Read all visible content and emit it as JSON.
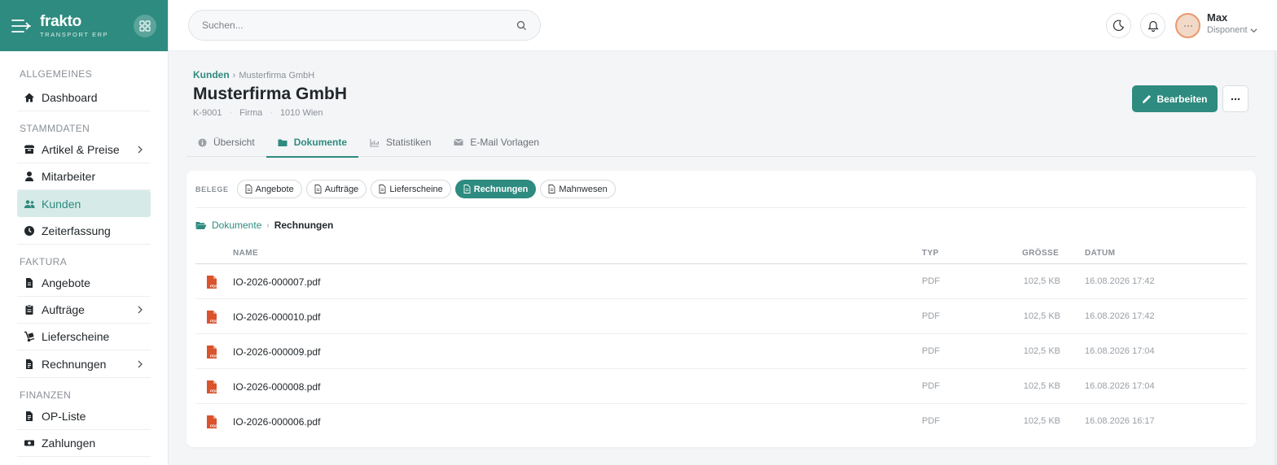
{
  "brand": {
    "name": "frakto",
    "tagline": "TRANSPORT ERP"
  },
  "sidebar": {
    "sections": [
      {
        "title": "ALLGEMEINES",
        "items": [
          {
            "label": "Dashboard",
            "icon": "home-icon"
          }
        ]
      },
      {
        "title": "STAMMDATEN",
        "items": [
          {
            "label": "Artikel & Preise",
            "icon": "box-icon",
            "chevron": true
          },
          {
            "label": "Mitarbeiter",
            "icon": "user-icon"
          },
          {
            "label": "Kunden",
            "icon": "users-icon",
            "active": true
          },
          {
            "label": "Zeiterfassung",
            "icon": "clock-icon"
          }
        ]
      },
      {
        "title": "FAKTURA",
        "items": [
          {
            "label": "Angebote",
            "icon": "document-icon"
          },
          {
            "label": "Aufträge",
            "icon": "clipboard-icon",
            "chevron": true
          },
          {
            "label": "Lieferscheine",
            "icon": "dolly-icon"
          },
          {
            "label": "Rechnungen",
            "icon": "invoice-icon",
            "chevron": true
          }
        ]
      },
      {
        "title": "FINANZEN",
        "items": [
          {
            "label": "OP-Liste",
            "icon": "invoice-icon"
          },
          {
            "label": "Zahlungen",
            "icon": "money-icon"
          }
        ]
      }
    ]
  },
  "header": {
    "search_placeholder": "Suchen...",
    "user": {
      "name": "Max",
      "role": "Disponent"
    }
  },
  "page": {
    "breadcrumb_link": "Kunden",
    "breadcrumb_current": "Musterfirma GmbH",
    "title": "Musterfirma GmbH",
    "meta": [
      "K-9001",
      "Firma",
      "1010 Wien"
    ],
    "edit_label": "Bearbeiten"
  },
  "tabs": [
    {
      "label": "Übersicht",
      "icon": "info-icon"
    },
    {
      "label": "Dokumente",
      "icon": "folder-icon",
      "active": true
    },
    {
      "label": "Statistiken",
      "icon": "chart-icon"
    },
    {
      "label": "E-Mail Vorlagen",
      "icon": "envelope-icon"
    }
  ],
  "documents": {
    "belege_label": "BELEGE",
    "chips": [
      {
        "label": "Angebote"
      },
      {
        "label": "Aufträge"
      },
      {
        "label": "Lieferscheine"
      },
      {
        "label": "Rechnungen",
        "active": true
      },
      {
        "label": "Mahnwesen"
      }
    ],
    "path_root": "Dokumente",
    "path_current": "Rechnungen",
    "columns": {
      "name": "NAME",
      "type": "TYP",
      "size": "GRÖSSE",
      "date": "DATUM"
    },
    "files": [
      {
        "name": "IO-2026-000007.pdf",
        "type": "PDF",
        "size": "102,5 KB",
        "date": "16.08.2026 17:42"
      },
      {
        "name": "IO-2026-000010.pdf",
        "type": "PDF",
        "size": "102,5 KB",
        "date": "16.08.2026 17:42"
      },
      {
        "name": "IO-2026-000009.pdf",
        "type": "PDF",
        "size": "102,5 KB",
        "date": "16.08.2026 17:04"
      },
      {
        "name": "IO-2026-000008.pdf",
        "type": "PDF",
        "size": "102,5 KB",
        "date": "16.08.2026 17:04"
      },
      {
        "name": "IO-2026-000006.pdf",
        "type": "PDF",
        "size": "102,5 KB",
        "date": "16.08.2026 16:17"
      }
    ]
  },
  "colors": {
    "accent": "#2e8b7f",
    "pdf": "#d9532c"
  }
}
